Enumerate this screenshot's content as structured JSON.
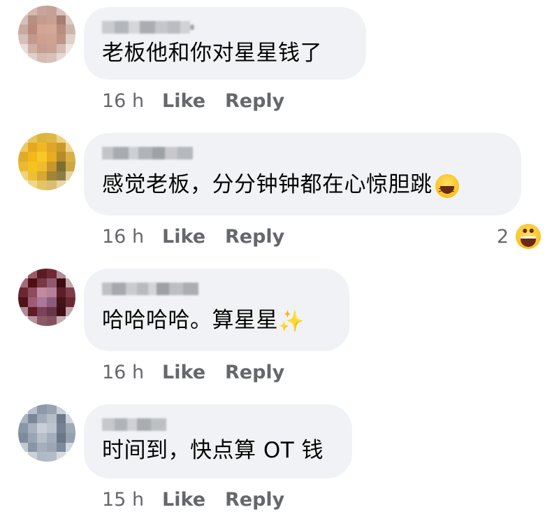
{
  "comments": [
    {
      "text": "老板他和你对星星钱了",
      "time": "16 h",
      "like": "Like",
      "reply": "Reply",
      "reaction_count": "",
      "avatar_colors": [
        "#d9c4be",
        "#c9a79c",
        "#b98f85",
        "#cdb1a8",
        "#e3d3ce",
        "#bfa096"
      ]
    },
    {
      "text": "感觉老板，分分钟钟都在心惊胆跳",
      "emoji": "laughing-squint-emoji",
      "time": "16 h",
      "like": "Like",
      "reply": "Reply",
      "reaction_count": "2",
      "reaction_emoji": "grinning-emoji",
      "avatar_colors": [
        "#e8b341",
        "#f0c23c",
        "#c9941e",
        "#f5d06a",
        "#8a7a3a",
        "#dcaa2c"
      ]
    },
    {
      "text": "哈哈哈哈。算星星",
      "emoji": "sparkles-icon",
      "time": "16 h",
      "like": "Like",
      "reply": "Reply",
      "reaction_count": "",
      "avatar_colors": [
        "#5a1f22",
        "#8b3a4a",
        "#a36a7d",
        "#3e1418",
        "#c090a0",
        "#6e2c35"
      ]
    },
    {
      "text": "时间到，快点算 OT 钱",
      "time": "15 h",
      "like": "Like",
      "reply": "Reply",
      "reaction_count": "",
      "avatar_colors": [
        "#8a97a8",
        "#a6b2c2",
        "#6f7d90",
        "#c2ccd8",
        "#9aa5b3",
        "#7b8899"
      ]
    }
  ],
  "colors": {
    "bubble": "#f0f2f5",
    "text": "#050505",
    "meta": "#65676b"
  }
}
